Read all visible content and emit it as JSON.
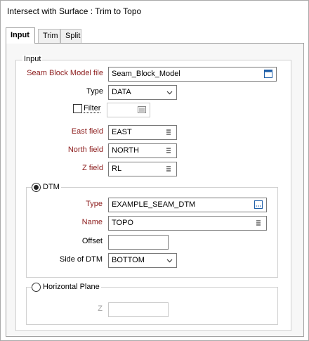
{
  "window": {
    "title": "Intersect with Surface : Trim to Topo"
  },
  "tabs": [
    {
      "label": "Input"
    },
    {
      "label": "Trim"
    },
    {
      "label": "Split"
    }
  ],
  "input_group": {
    "legend": "Input",
    "seam_block_model_file": {
      "label": "Seam Block Model file",
      "value": "Seam_Block_Model"
    },
    "type": {
      "label": "Type",
      "value": "DATA"
    },
    "filter": {
      "label": "Filter",
      "checked": false,
      "value": ""
    },
    "east_field": {
      "label": "East field",
      "value": "EAST"
    },
    "north_field": {
      "label": "North field",
      "value": "NORTH"
    },
    "z_field": {
      "label": "Z field",
      "value": "RL"
    }
  },
  "dtm_group": {
    "legend": "DTM",
    "selected": true,
    "type": {
      "label": "Type",
      "value": "EXAMPLE_SEAM_DTM"
    },
    "name": {
      "label": "Name",
      "value": "TOPO"
    },
    "offset": {
      "label": "Offset",
      "value": ""
    },
    "side_of_dtm": {
      "label": "Side of DTM",
      "value": "BOTTOM"
    }
  },
  "horizontal_plane_group": {
    "legend": "Horizontal Plane",
    "selected": false,
    "z": {
      "label": "Z",
      "value": ""
    }
  },
  "colors": {
    "required_label": "#8b1a1a",
    "disabled_label": "#a0a0a0"
  }
}
